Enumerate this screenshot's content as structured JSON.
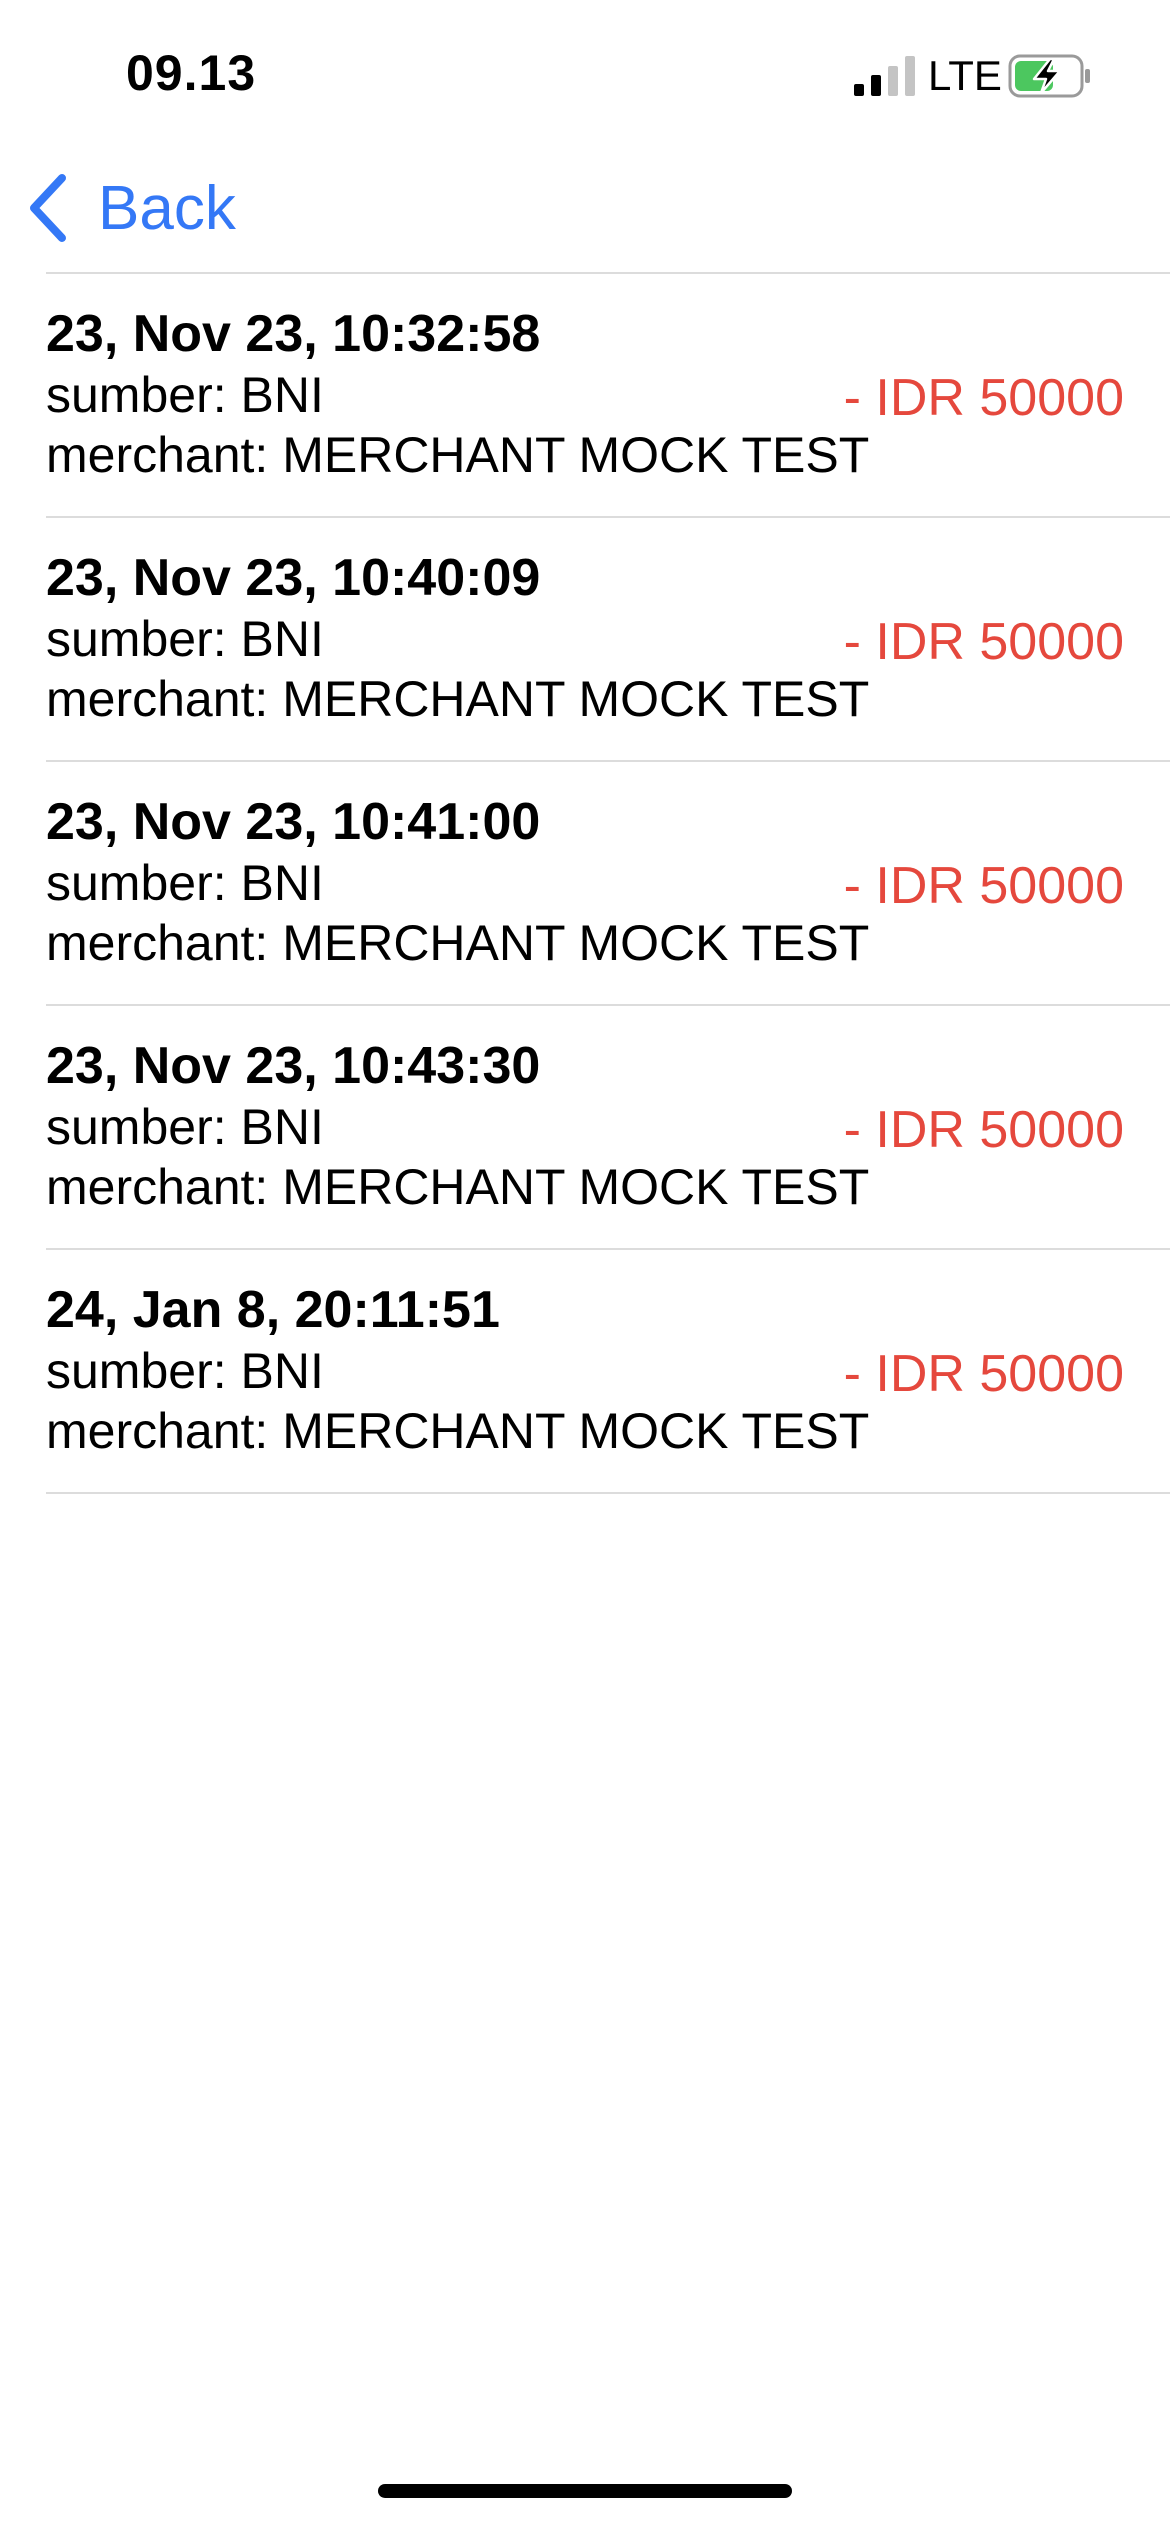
{
  "status_bar": {
    "time": "09.13",
    "network": "LTE",
    "signal_icon": "cellular-signal-icon",
    "battery_icon": "battery-charging-icon"
  },
  "nav": {
    "back_label": "Back",
    "back_icon": "chevron-left-icon",
    "accent_color": "#3478f6"
  },
  "amount_color": "#e5483d",
  "transactions": [
    {
      "date": "23, Nov 23, 10:32:58",
      "source": "sumber: BNI",
      "merchant": "merchant: MERCHANT MOCK TEST",
      "amount": "- IDR 50000"
    },
    {
      "date": "23, Nov 23, 10:40:09",
      "source": "sumber: BNI",
      "merchant": "merchant: MERCHANT MOCK TEST",
      "amount": "- IDR 50000"
    },
    {
      "date": "23, Nov 23, 10:41:00",
      "source": "sumber: BNI",
      "merchant": "merchant: MERCHANT MOCK TEST",
      "amount": "- IDR 50000"
    },
    {
      "date": "23, Nov 23, 10:43:30",
      "source": "sumber: BNI",
      "merchant": "merchant: MERCHANT MOCK TEST",
      "amount": "- IDR 50000"
    },
    {
      "date": "24, Jan 8, 20:11:51",
      "source": "sumber: BNI",
      "merchant": "merchant: MERCHANT MOCK TEST",
      "amount": "- IDR 50000"
    }
  ]
}
